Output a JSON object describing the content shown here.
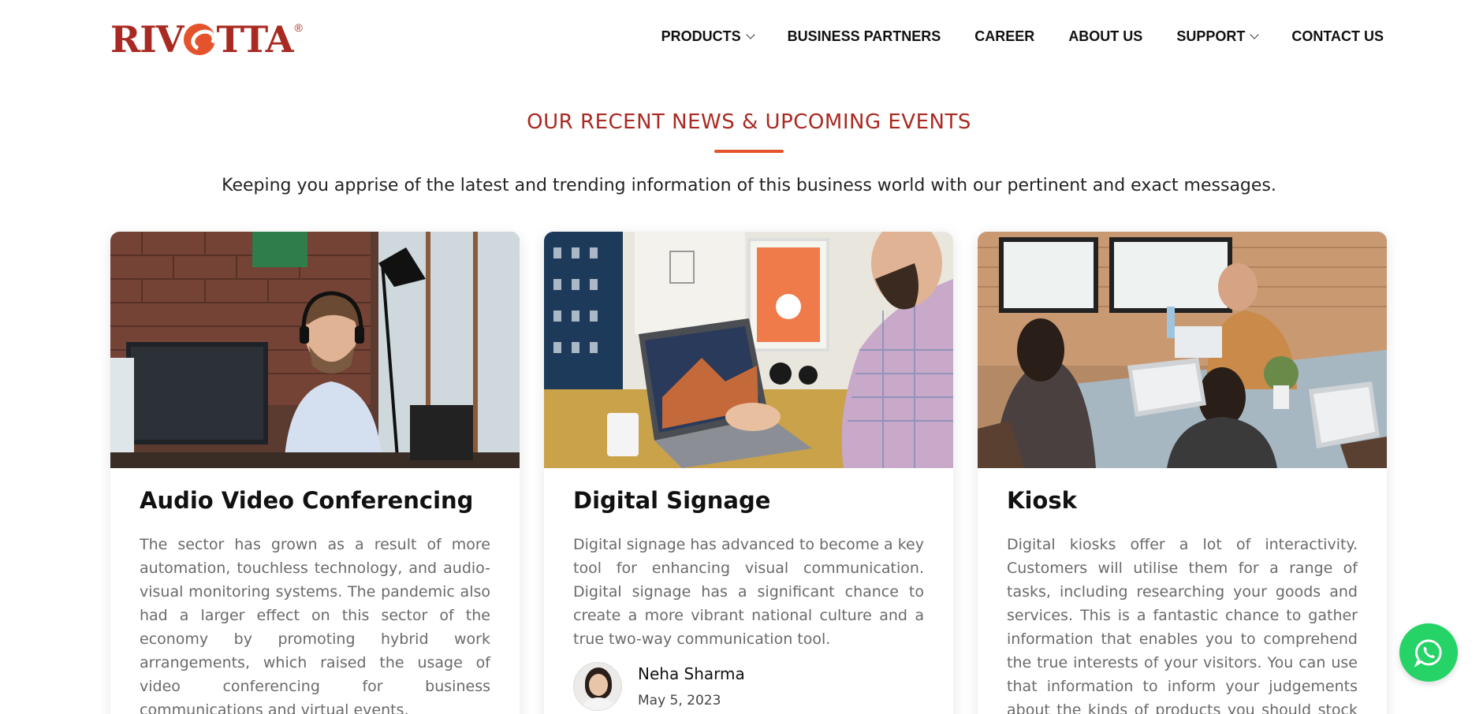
{
  "brand": {
    "logo_text_left": "RIV",
    "logo_text_right": "TTA",
    "logo_reg": "®",
    "brand_color": "#a92a22",
    "accent_color": "#e5532d"
  },
  "nav": {
    "items": [
      {
        "label": "PRODUCTS",
        "dropdown": true
      },
      {
        "label": "BUSINESS PARTNERS",
        "dropdown": false
      },
      {
        "label": "CAREER",
        "dropdown": false
      },
      {
        "label": "ABOUT US",
        "dropdown": false
      },
      {
        "label": "SUPPORT",
        "dropdown": true
      },
      {
        "label": "CONTACT US",
        "dropdown": false
      }
    ]
  },
  "section": {
    "title": "OUR RECENT NEWS & UPCOMING EVENTS",
    "subtitle": "Keeping you apprise of the latest and trending information of this business world with our pertinent and exact messages."
  },
  "cards": [
    {
      "title": "Audio Video Conferencing",
      "text": "The sector has grown as a result of more automation, touchless technology, and audio-visual monitoring systems. The pandemic also had a larger effect on this sector of the economy by promoting hybrid work arrangements, which raised the usage of video conferencing for business communications and virtual events."
    },
    {
      "title": "Digital Signage",
      "text": "Digital signage has advanced to become a key tool for enhancing visual communication. Digital signage has a significant chance to create a more vibrant national culture and a true two-way communication tool.",
      "author": {
        "name": "Neha Sharma",
        "date": "May 5, 2023"
      }
    },
    {
      "title": "Kiosk",
      "text": "Digital kiosks offer a lot of interactivity. Customers will utilise them for a range of tasks, including researching your goods and services. This is a fantastic chance to gather information that enables you to comprehend the true interests of your visitors. You can use that information to inform your judgements about the kinds of products you should stock and the"
    }
  ],
  "whatsapp": {
    "icon": "whatsapp-icon",
    "color": "#25d366"
  }
}
